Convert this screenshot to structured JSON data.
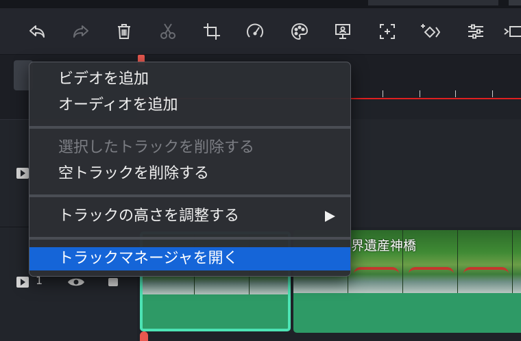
{
  "toolbar": {
    "buttons": [
      {
        "name": "undo",
        "icon": "undo-icon"
      },
      {
        "name": "redo",
        "icon": "redo-icon"
      },
      {
        "name": "delete",
        "icon": "trash-icon"
      },
      {
        "name": "cut",
        "icon": "scissors-icon"
      },
      {
        "name": "crop",
        "icon": "crop-icon"
      },
      {
        "name": "speed",
        "icon": "speedometer-icon"
      },
      {
        "name": "color",
        "icon": "palette-icon"
      },
      {
        "name": "presentation",
        "icon": "presentation-icon"
      },
      {
        "name": "auto-reframe",
        "icon": "reframe-icon"
      },
      {
        "name": "keyframe",
        "icon": "keyframe-icon"
      },
      {
        "name": "adjust",
        "icon": "sliders-icon"
      },
      {
        "name": "more",
        "icon": "export-icon"
      }
    ]
  },
  "tracks": [
    {
      "number": ""
    },
    {
      "number": "1"
    }
  ],
  "clips": [
    {
      "title": ""
    },
    {
      "title": "界遺産神橋"
    }
  ],
  "context_menu": {
    "items": [
      {
        "label": "ビデオを追加",
        "enabled": true
      },
      {
        "label": "オーディオを追加",
        "enabled": true
      },
      {
        "label": "選択したトラックを削除する",
        "enabled": false
      },
      {
        "label": "空トラックを削除する",
        "enabled": true
      },
      {
        "label": "トラックの高さを調整する",
        "enabled": true,
        "submenu": true
      },
      {
        "label": "トラックマネージャを開く",
        "enabled": true,
        "selected": true
      }
    ]
  },
  "colors": {
    "accent_selected": "#1565d8",
    "playhead": "#e8584f",
    "timeline_line": "#e02020",
    "clip_green": "#2e9a66",
    "clip_selected_border": "#4de3b4"
  }
}
